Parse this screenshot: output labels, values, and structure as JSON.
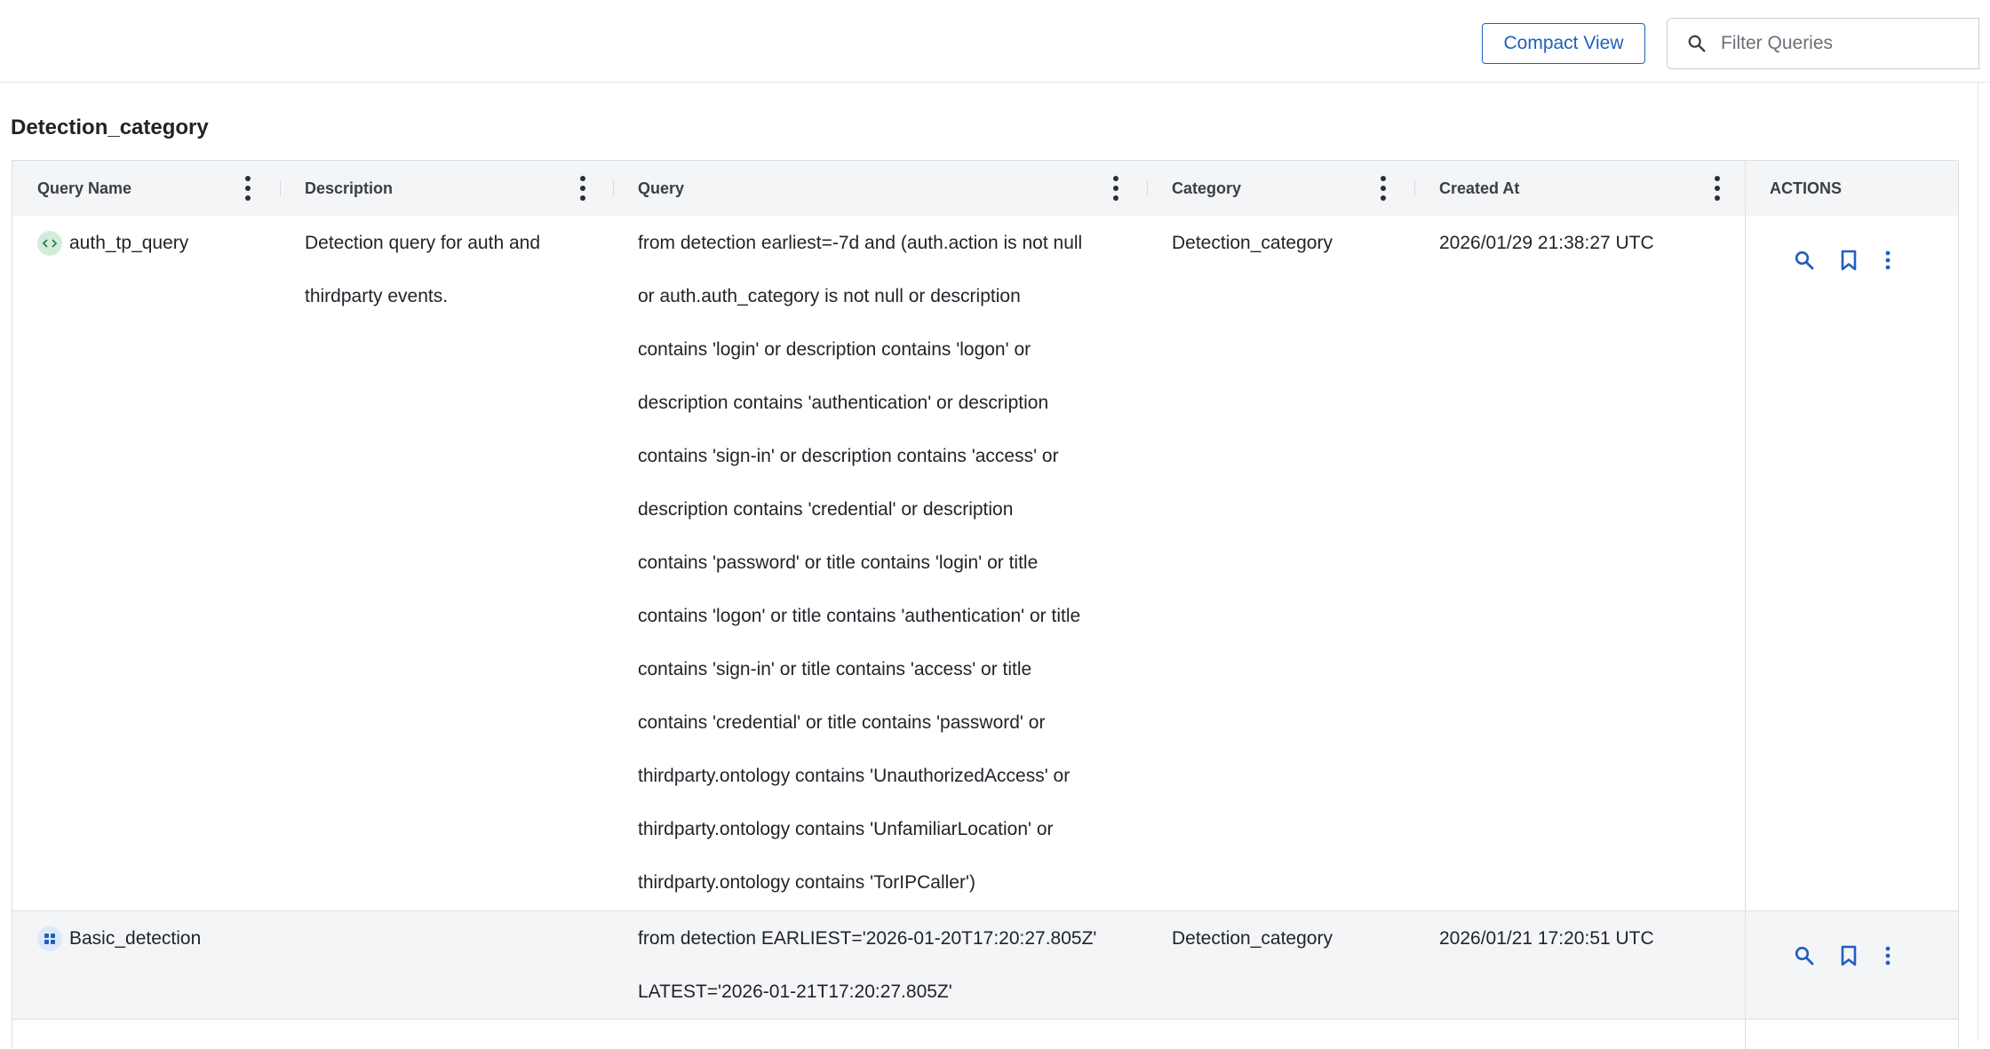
{
  "toolbar": {
    "compact_view_label": "Compact View",
    "filter_placeholder": "Filter Queries"
  },
  "section": {
    "title": "Detection_category"
  },
  "table": {
    "columns": [
      "Query Name",
      "Description",
      "Query",
      "Category",
      "Created At",
      "ACTIONS"
    ],
    "rows": [
      {
        "name": "auth_tp_query",
        "icon": "code-icon",
        "description_lines": [
          "Detection query for auth and",
          "thirdparty events."
        ],
        "query_lines": [
          "from detection earliest=-7d and (auth.action is not null",
          "or auth.auth_category is not null or description",
          "contains 'login' or description contains 'logon' or",
          "description contains 'authentication' or description",
          "contains 'sign-in' or description contains 'access' or",
          "description contains 'credential' or description",
          "contains 'password' or title contains 'login' or title",
          "contains 'logon' or title contains 'authentication' or title",
          "contains 'sign-in' or title contains 'access' or title",
          "contains 'credential' or title contains 'password' or",
          "thirdparty.ontology contains 'UnauthorizedAccess' or",
          "thirdparty.ontology contains 'UnfamiliarLocation' or",
          "thirdparty.ontology contains 'TorIPCaller')"
        ],
        "category": "Detection_category",
        "created_at": "2026/01/29 21:38:27 UTC"
      },
      {
        "name": "Basic_detection",
        "icon": "grid-icon",
        "description_lines": [],
        "query_lines": [
          "from detection EARLIEST='2026-01-20T17:20:27.805Z'",
          "LATEST='2026-01-21T17:20:27.805Z'"
        ],
        "category": "Detection_category",
        "created_at": "2026/01/21 17:20:51 UTC"
      }
    ]
  },
  "colors": {
    "accent": "#1f5fbf",
    "header_bg": "#f4f5f6",
    "row_alt_bg": "#f4f5f6",
    "code_icon_bg": "#d3ecd9",
    "grid_icon_bg": "#dde9fb"
  }
}
